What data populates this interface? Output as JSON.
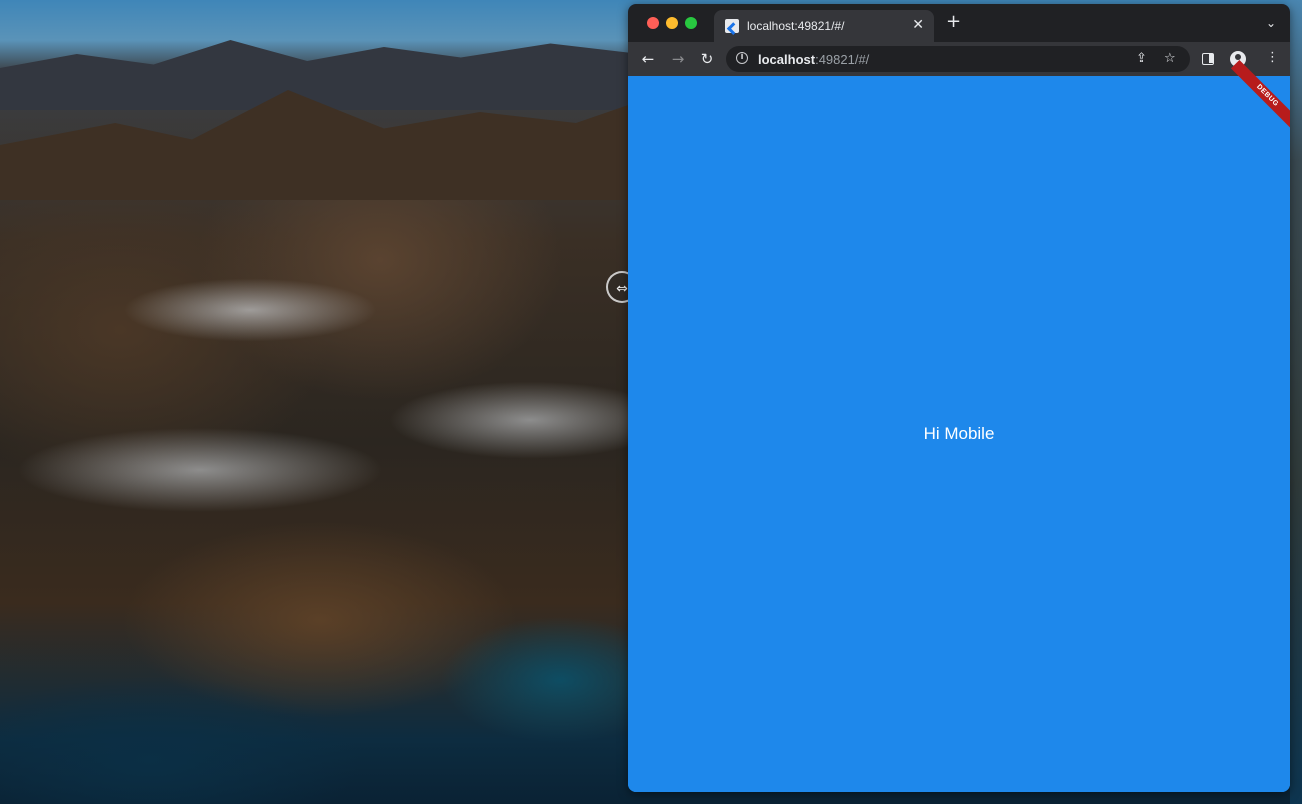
{
  "browser": {
    "tab": {
      "title": "localhost:49821/#/",
      "close_glyph": "✕"
    },
    "new_tab_glyph": "+",
    "tab_search_glyph": "⌄",
    "nav": {
      "back_glyph": "←",
      "forward_glyph": "→",
      "reload_glyph": "↻"
    },
    "address": {
      "host": "localhost",
      "rest": ":49821/#/",
      "info_glyph": "i"
    },
    "icons": {
      "share": "share-icon",
      "share_glyph": "⇪",
      "star": "star-icon",
      "star_glyph": "☆",
      "menu_glyph": "⋮"
    }
  },
  "app": {
    "debug_banner": "DEBUG",
    "body_text": "Hi Mobile",
    "background_color": "#1e88eb"
  },
  "desktop": {
    "resize_handle_glyph": "⇔"
  },
  "colors": {
    "traffic_red": "#ff5f57",
    "traffic_yellow": "#febc2e",
    "traffic_green": "#28c840",
    "tab_strip": "#202124",
    "toolbar": "#35363a"
  }
}
